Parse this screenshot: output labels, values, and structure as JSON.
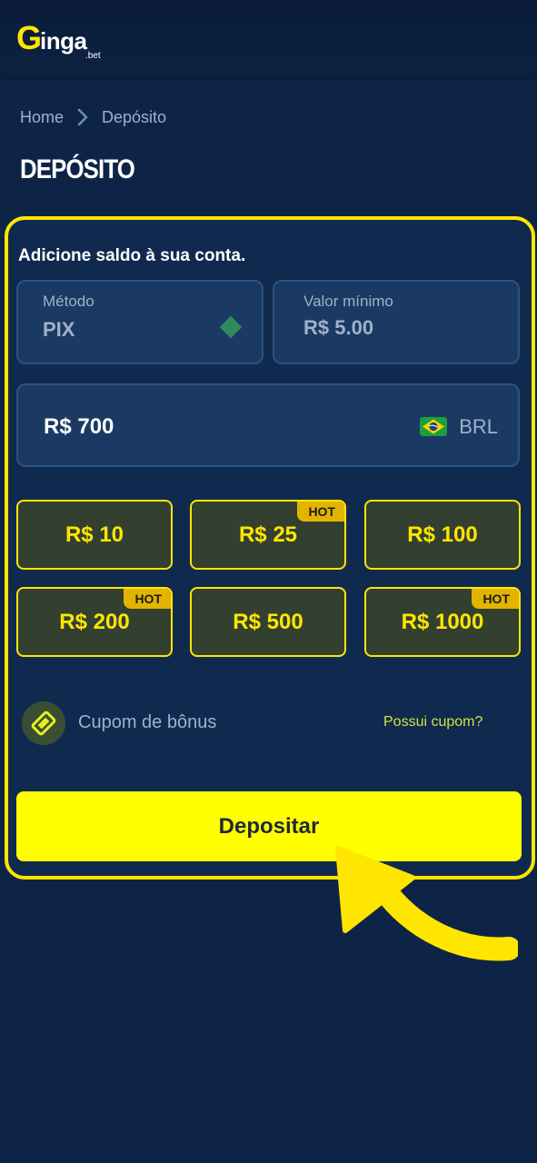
{
  "header": {
    "logo_g": "G",
    "logo_rest": "inga",
    "logo_sub": ".bet"
  },
  "breadcrumb": {
    "home": "Home",
    "current": "Depósito"
  },
  "page": {
    "title": "DEPÓSITO"
  },
  "card": {
    "title": "Adicione saldo à sua conta.",
    "method": {
      "label": "Método",
      "value": "PIX",
      "icon": "pix-icon"
    },
    "minimum": {
      "label": "Valor mínimo",
      "value": "R$ 5.00"
    },
    "amount": {
      "value": "R$ 700",
      "currency": "BRL",
      "flag": "brazil-flag-icon"
    },
    "quick_amounts": [
      {
        "label": "R$ 10",
        "hot": ""
      },
      {
        "label": "R$ 25",
        "hot": "HOT"
      },
      {
        "label": "R$ 100",
        "hot": ""
      },
      {
        "label": "R$ 200",
        "hot": "HOT"
      },
      {
        "label": "R$ 500",
        "hot": ""
      },
      {
        "label": "R$ 1000",
        "hot": "HOT"
      }
    ],
    "coupon": {
      "label": "Cupom de bônus",
      "link": "Possui cupom?",
      "icon": "ticket-icon"
    },
    "deposit_button": "Depositar"
  },
  "colors": {
    "background": "#0e2447",
    "accent": "#ffe600",
    "button": "#ffff00",
    "hot_badge": "#e2b400"
  }
}
